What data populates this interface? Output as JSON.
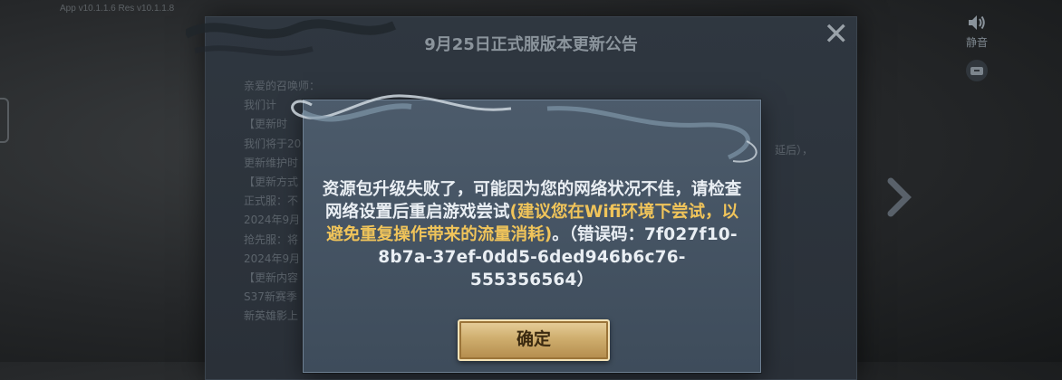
{
  "app": {
    "version_text": "App v10.1.1.6 Res v10.1.1.8"
  },
  "announcement": {
    "title": "9月25日正式服版本更新公告",
    "close_icon": "close-icon",
    "lines": [
      "亲爱的召唤师：",
      "我们计",
      "【更新时",
      "我们将于20",
      "更新维护时",
      "【更新方式",
      "正式服：不",
      "2024年9月",
      "抢先服：将",
      "2024年9月",
      "【更新内容",
      "S37新赛季",
      "新英雄影上"
    ],
    "right_fragment": "延后），"
  },
  "side": {
    "mute_label": "静音",
    "mute_icon": "speaker-icon",
    "mail_icon": "mailbox-icon",
    "next_icon": "chevron-right-icon"
  },
  "dialog": {
    "msg_part1": "资源包升级失败了，可能因为您的网络状况不佳，请检查网络设置后重启游戏尝试",
    "msg_highlight": "(建议您在Wifi环境下尝试，以避免重复操作带来的流量消耗)",
    "msg_part2": "。（错误码：",
    "error_code": "7f027f10-8b7a-37ef-0dd5-6ded946b6c76-555356564",
    "msg_end": "）",
    "confirm_label": "确定"
  },
  "colors": {
    "highlight": "#f0c45a",
    "dialog_bg": "#46546a",
    "button_gold": "#cfae6e"
  }
}
